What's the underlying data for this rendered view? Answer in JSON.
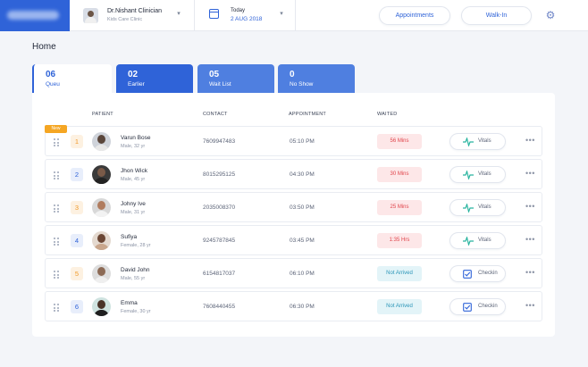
{
  "header": {
    "doctor_name": "Dr.Nishant Clinician",
    "clinic": "Kids Care Clinic",
    "date_label": "Today",
    "date_value": "2 AUG 2018",
    "appointments_button": "Appointments",
    "walkin_button": "Walk-In",
    "icons": [
      "logo",
      "calendar-icon",
      "chevron-down-icon",
      "gear-icon"
    ]
  },
  "page": {
    "title": "Home"
  },
  "tabs": [
    {
      "count": "06",
      "label": "Queu"
    },
    {
      "count": "02",
      "label": "Earlier"
    },
    {
      "count": "05",
      "label": "Wait List"
    },
    {
      "count": "0",
      "label": "No Show"
    }
  ],
  "table": {
    "headers": {
      "patient": "PATIENT",
      "contact": "CONTACT",
      "appointment": "APPOINTMENT",
      "waited": "WAITED"
    },
    "new_badge": "New",
    "rows": [
      {
        "index": "1",
        "name": "Varun Bose",
        "meta": "Male, 32 yr",
        "contact": "7609947483",
        "time": "05:10 PM",
        "waited": "56 Mins",
        "action": "Vitals"
      },
      {
        "index": "2",
        "name": "Jhon Wick",
        "meta": "Male, 45 yr",
        "contact": "8015295125",
        "time": "04:30 PM",
        "waited": "30 Mins",
        "action": "Vitals"
      },
      {
        "index": "3",
        "name": "Johny Ive",
        "meta": "Male, 31 yr",
        "contact": "2035008370",
        "time": "03:50 PM",
        "waited": "25 Mins",
        "action": "Vitals"
      },
      {
        "index": "4",
        "name": "Sufiya",
        "meta": "Female, 28 yr",
        "contact": "9245787845",
        "time": "03:45 PM",
        "waited": "1:35 Hrs",
        "action": "Vitals"
      },
      {
        "index": "5",
        "name": "David John",
        "meta": "Male, 55 yr",
        "contact": "6154817037",
        "time": "06:10 PM",
        "waited": "Not Arrived",
        "action": "Checkin"
      },
      {
        "index": "6",
        "name": "Emma",
        "meta": "Female, 30 yr",
        "contact": "7608440455",
        "time": "06:30 PM",
        "waited": "Not Arrived",
        "action": "Checkin"
      }
    ]
  },
  "colors": {
    "accent": "#2f63d8",
    "late": "#e0444b",
    "not_arrived": "#2a95b8",
    "new_badge": "#f5a623"
  }
}
